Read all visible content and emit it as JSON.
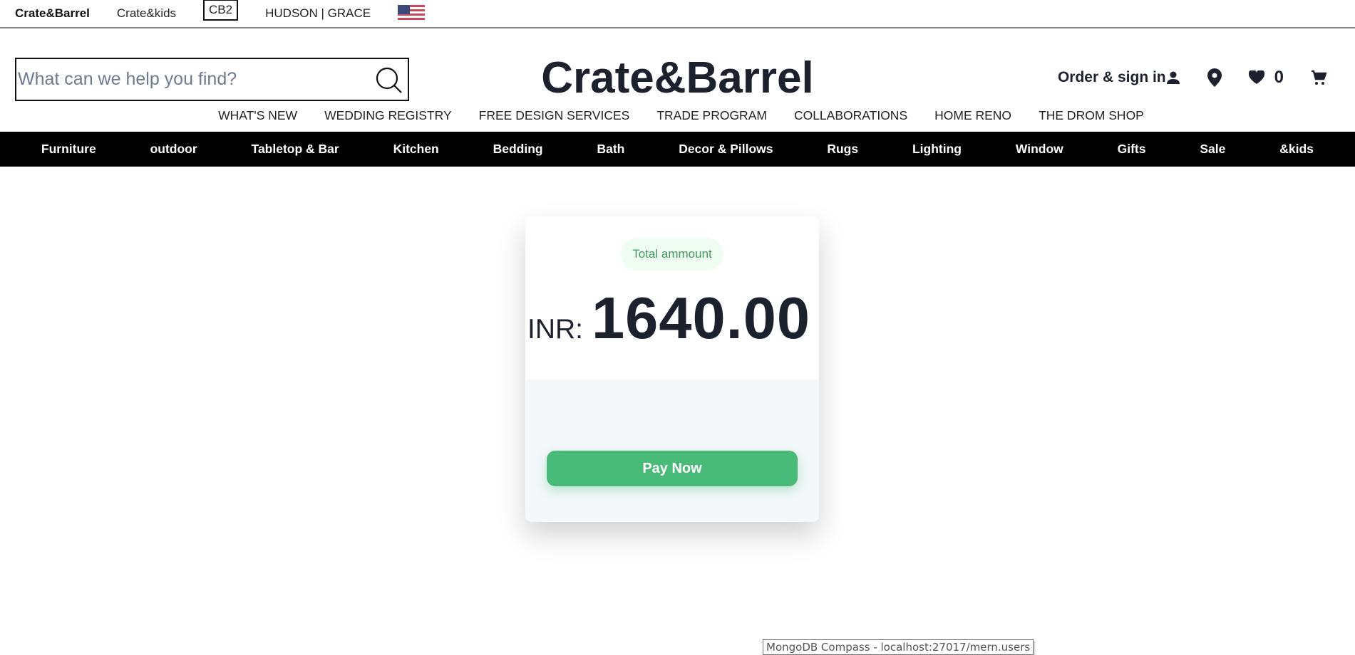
{
  "topbar": {
    "brands": [
      "Crate&Barrel",
      "Crate&kids",
      "CB2",
      "HUDSON | GRACE"
    ]
  },
  "header": {
    "search_placeholder": "What can we help you find?",
    "logo": "Crate&Barrel",
    "sign_in": "Order & sign in",
    "wishlist_count": "0"
  },
  "nav": [
    "WHAT'S NEW",
    "WEDDING REGISTRY",
    "FREE DESIGN SERVICES",
    "TRADE PROGRAM",
    "COLLABORATIONS",
    "HOME RENO",
    "THE DROM SHOP"
  ],
  "categories": [
    "Furniture",
    "outdoor",
    "Tabletop & Bar",
    "Kitchen",
    "Bedding",
    "Bath",
    "Decor & Pillows",
    "Rugs",
    "Lighting",
    "Window",
    "Gifts",
    "Sale",
    "&kids"
  ],
  "payment": {
    "label": "Total ammount",
    "currency": "INR:",
    "amount": "1640.00",
    "pay_label": "Pay Now"
  },
  "tooltip": "MongoDB Compass - localhost:27017/mern.users",
  "colors": {
    "accent": "#48bb78",
    "text": "#1c212d"
  }
}
